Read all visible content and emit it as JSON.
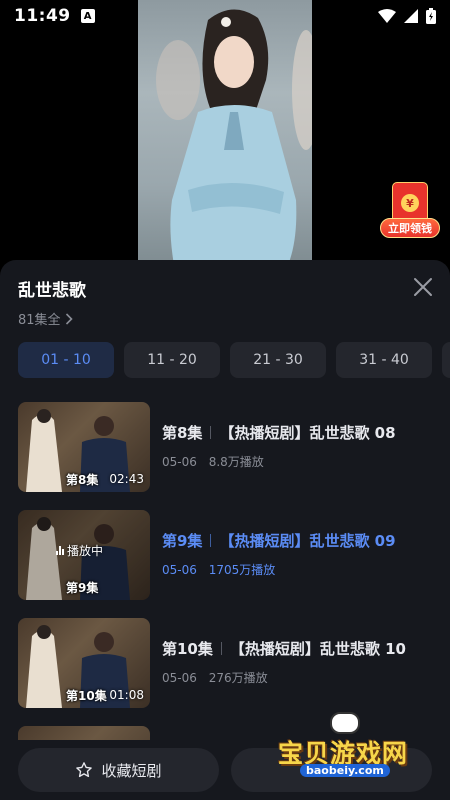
{
  "status_bar": {
    "time": "11:49",
    "notification_icon": "A"
  },
  "video": {
    "red_envelope_label": "立即领钱",
    "red_envelope_symbol": "¥"
  },
  "panel": {
    "title": "乱世悲歌",
    "episode_total": "81集全",
    "range_tabs": [
      "01 - 10",
      "11 - 20",
      "21 - 30",
      "31 - 40"
    ],
    "active_range": "01 - 10",
    "episodes": [
      {
        "number": "第8集",
        "title": "【热播短剧】乱世悲歌 08",
        "date": "05-06",
        "views": "8.8万播放",
        "thumb_label": "第8集",
        "duration": "02:43",
        "playing": ""
      },
      {
        "number": "第9集",
        "title": "【热播短剧】乱世悲歌 09",
        "date": "05-06",
        "views": "1705万播放",
        "thumb_label": "第9集",
        "duration": "",
        "playing": "播放中"
      },
      {
        "number": "第10集",
        "title": "【热播短剧】乱世悲歌 10",
        "date": "05-06",
        "views": "276万播放",
        "thumb_label": "第10集",
        "duration": "01:08",
        "playing": ""
      }
    ]
  },
  "bottom_bar": {
    "favorite_label": "收藏短剧"
  },
  "watermark": {
    "text": "宝贝游戏网",
    "url": "baobeiy.com"
  },
  "colors": {
    "accent": "#5b8cf5",
    "panel_bg": "#16181e",
    "tab_bg": "#24262d"
  },
  "icons": {
    "close": "close-icon",
    "chevron": "chevron-right-icon",
    "star": "star-icon",
    "share": "share-icon"
  }
}
